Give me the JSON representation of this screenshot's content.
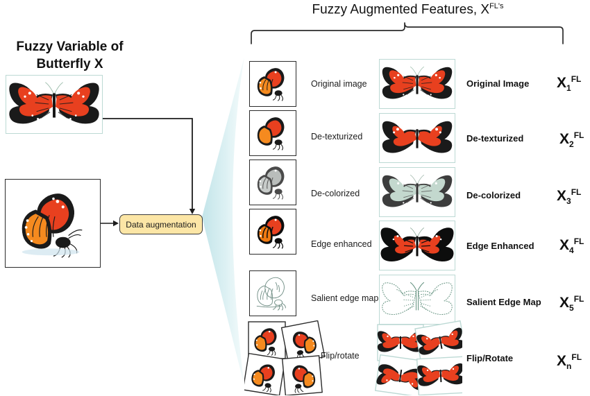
{
  "figure": {
    "left_title_line1": "Fuzzy Variable of",
    "left_title_line2": "Butterfly  X",
    "top_title_main": "Fuzzy Augmented Features, X",
    "top_title_sup": "FL's",
    "process_box_label": "Data augmentation",
    "accent_teal": "#bcd9d4",
    "funnel_color": "#cfe9ec",
    "box_fill": "#fce6a6",
    "box_border": "#3a3a3a",
    "monarch_orange": "#e8401f",
    "monarch_amber": "#f58a1f",
    "wing_black": "#1a1a1a",
    "desaturated_green": "#c3d8ce",
    "edge_line_green": "#5f8f7c"
  },
  "source_images": [
    {
      "name": "fuzzy-variable-top",
      "view": "spread-wing",
      "style": "original"
    },
    {
      "name": "fuzzy-variable-bottom",
      "view": "side-profile",
      "style": "original"
    }
  ],
  "rows": [
    {
      "mid_label": "Original image",
      "right_label": "Original Image",
      "x_base": "X",
      "x_sub": "1",
      "x_sup": "FL",
      "style": "original"
    },
    {
      "mid_label": "De-texturized",
      "right_label": "De-texturized",
      "x_base": "X",
      "x_sub": "2",
      "x_sup": "FL",
      "style": "detextured"
    },
    {
      "mid_label": "De-colorized",
      "right_label": "De-colorized",
      "x_base": "X",
      "x_sub": "3",
      "x_sup": "FL",
      "style": "decolorized"
    },
    {
      "mid_label": "Edge enhanced",
      "right_label": "Edge Enhanced",
      "x_base": "X",
      "x_sub": "4",
      "x_sup": "FL",
      "style": "edge"
    },
    {
      "mid_label": "Salient edge map",
      "right_label": "Salient Edge Map",
      "x_base": "X",
      "x_sub": "5",
      "x_sup": "FL",
      "style": "saliency"
    },
    {
      "mid_label": "Flip/rotate",
      "right_label": "Flip/Rotate",
      "x_base": "X",
      "x_sub": "n",
      "x_sup": "FL",
      "style": "fliprotate"
    }
  ]
}
